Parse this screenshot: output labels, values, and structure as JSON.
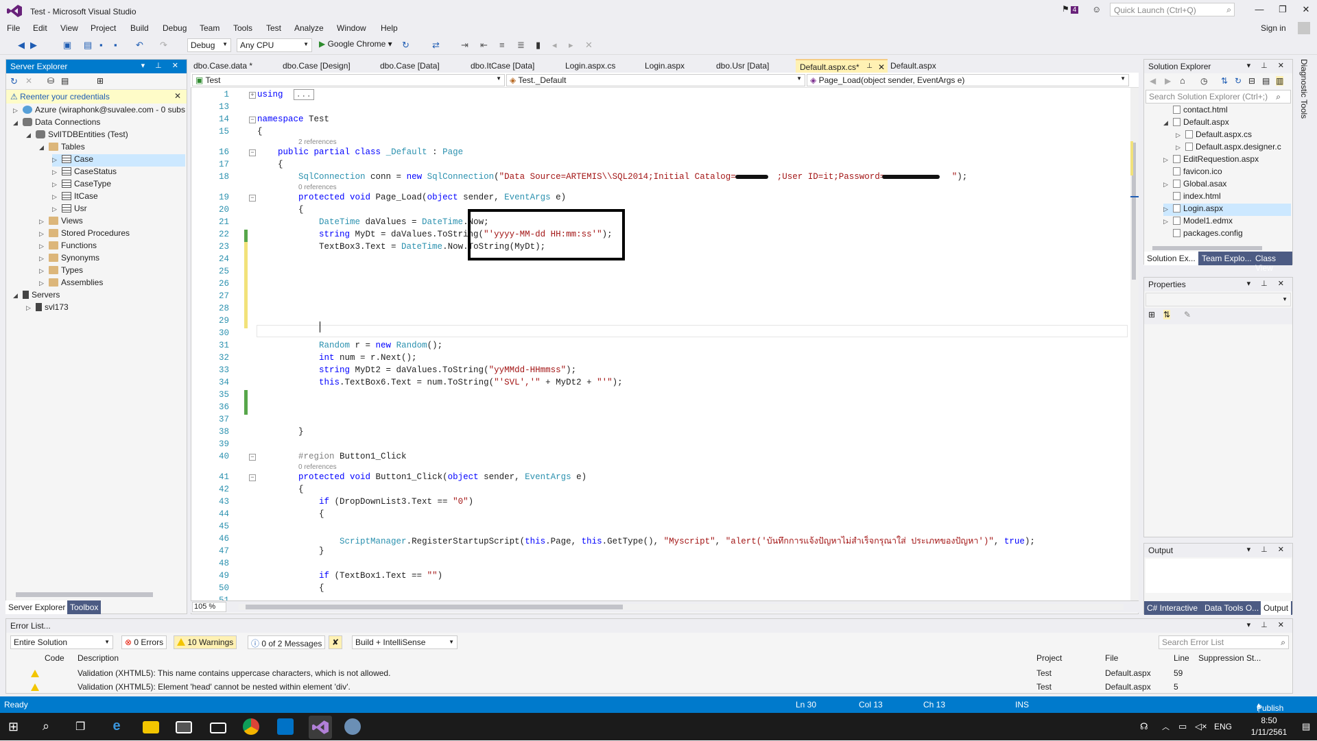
{
  "title": "Test - Microsoft Visual Studio",
  "notif_count": "4",
  "quick_launch_placeholder": "Quick Launch (Ctrl+Q)",
  "menu": [
    "File",
    "Edit",
    "View",
    "Project",
    "Build",
    "Debug",
    "Team",
    "Tools",
    "Test",
    "Analyze",
    "Window",
    "Help"
  ],
  "sign_in": "Sign in",
  "toolbar": {
    "config": "Debug",
    "platform": "Any CPU",
    "run": "Google Chrome"
  },
  "server_explorer": {
    "title": "Server Explorer",
    "warning": "Reenter your credentials",
    "tree": [
      {
        "label": "Azure (wiraphonk@suvalee.com - 0 subs",
        "depth": 0,
        "tw": "▷",
        "icon": "azure"
      },
      {
        "label": "Data Connections",
        "depth": 0,
        "tw": "◢",
        "icon": "db"
      },
      {
        "label": "SvlITDBEntities (Test)",
        "depth": 1,
        "tw": "◢",
        "icon": "db"
      },
      {
        "label": "Tables",
        "depth": 2,
        "tw": "◢",
        "icon": "folder"
      },
      {
        "label": "Case",
        "depth": 3,
        "tw": "▷",
        "icon": "table",
        "selected": true
      },
      {
        "label": "CaseStatus",
        "depth": 3,
        "tw": "▷",
        "icon": "table"
      },
      {
        "label": "CaseType",
        "depth": 3,
        "tw": "▷",
        "icon": "table"
      },
      {
        "label": "ItCase",
        "depth": 3,
        "tw": "▷",
        "icon": "table"
      },
      {
        "label": "Usr",
        "depth": 3,
        "tw": "▷",
        "icon": "table"
      },
      {
        "label": "Views",
        "depth": 2,
        "tw": "▷",
        "icon": "folder"
      },
      {
        "label": "Stored Procedures",
        "depth": 2,
        "tw": "▷",
        "icon": "folder"
      },
      {
        "label": "Functions",
        "depth": 2,
        "tw": "▷",
        "icon": "folder"
      },
      {
        "label": "Synonyms",
        "depth": 2,
        "tw": "▷",
        "icon": "folder"
      },
      {
        "label": "Types",
        "depth": 2,
        "tw": "▷",
        "icon": "folder"
      },
      {
        "label": "Assemblies",
        "depth": 2,
        "tw": "▷",
        "icon": "folder"
      },
      {
        "label": "Servers",
        "depth": 0,
        "tw": "◢",
        "icon": "server"
      },
      {
        "label": "svl173",
        "depth": 1,
        "tw": "▷",
        "icon": "server"
      }
    ],
    "tabs": [
      "Server Explorer",
      "Toolbox"
    ]
  },
  "doc_tabs": [
    "dbo.Case.data *",
    "dbo.Case [Design]",
    "dbo.Case [Data]",
    "dbo.ItCase [Data]",
    "Login.aspx.cs",
    "Login.aspx",
    "dbo.Usr [Data]",
    "Default.aspx.cs*",
    "Default.aspx"
  ],
  "nav": {
    "project": "Test",
    "class": "Test._Default",
    "member": "Page_Load(object sender, EventArgs e)"
  },
  "zoom": "105 %",
  "code_lines": [
    {
      "n": "1",
      "t": [
        [
          "kw",
          "using"
        ],
        [
          "",
          "  "
        ],
        [
          "rg",
          "..."
        ]
      ]
    },
    {
      "n": "13",
      "t": []
    },
    {
      "n": "14",
      "t": [
        [
          "kw",
          "namespace"
        ],
        [
          "",
          " Test"
        ]
      ]
    },
    {
      "n": "15",
      "t": [
        [
          "",
          "{"
        ]
      ]
    },
    {
      "n": "16",
      "t": [
        [
          "",
          "    "
        ],
        [
          "kw",
          "public partial class"
        ],
        [
          "",
          " "
        ],
        [
          "ty",
          "_Default"
        ],
        [
          "",
          " : "
        ],
        [
          "ty",
          "Page"
        ]
      ],
      "refs": "2 references"
    },
    {
      "n": "17",
      "t": [
        [
          "",
          "    {"
        ]
      ]
    },
    {
      "n": "18",
      "t": [
        [
          "",
          "        "
        ],
        [
          "ty",
          "SqlConnection"
        ],
        [
          "",
          " conn = "
        ],
        [
          "kw",
          "new"
        ],
        [
          "",
          " "
        ],
        [
          "ty",
          "SqlConnection"
        ],
        [
          "",
          "("
        ],
        [
          "st",
          "\"Data Source=ARTEMIS\\\\SQL2014;Initial Catalog=        ;User ID=it;Password=             \""
        ],
        [
          "",
          ");"
        ]
      ]
    },
    {
      "n": "19",
      "t": [
        [
          "",
          "        "
        ],
        [
          "kw",
          "protected void"
        ],
        [
          "",
          " Page_Load("
        ],
        [
          "kw",
          "object"
        ],
        [
          "",
          " sender, "
        ],
        [
          "ty",
          "EventArgs"
        ],
        [
          "",
          " e)"
        ]
      ],
      "refs": "0 references"
    },
    {
      "n": "20",
      "t": [
        [
          "",
          "        {"
        ]
      ]
    },
    {
      "n": "21",
      "t": [
        [
          "",
          "            "
        ],
        [
          "ty",
          "DateTime"
        ],
        [
          "",
          " daValues = "
        ],
        [
          "ty",
          "DateTime"
        ],
        [
          "",
          ".Now;"
        ]
      ]
    },
    {
      "n": "22",
      "t": [
        [
          "",
          "            "
        ],
        [
          "kw",
          "string"
        ],
        [
          "",
          " MyDt = daValues.ToString("
        ],
        [
          "st",
          "\"'yyyy-MM-dd HH:mm:ss'\""
        ],
        [
          "",
          ");"
        ]
      ]
    },
    {
      "n": "23",
      "t": [
        [
          "",
          "            TextBox3.Text = "
        ],
        [
          "ty",
          "DateTime"
        ],
        [
          "",
          ".Now.ToString(MyDt);"
        ]
      ]
    },
    {
      "n": "24",
      "t": []
    },
    {
      "n": "25",
      "t": []
    },
    {
      "n": "26",
      "t": []
    },
    {
      "n": "27",
      "t": []
    },
    {
      "n": "28",
      "t": []
    },
    {
      "n": "29",
      "t": []
    },
    {
      "n": "30",
      "t": []
    },
    {
      "n": "31",
      "t": [
        [
          "",
          "            "
        ],
        [
          "ty",
          "Random"
        ],
        [
          "",
          " r = "
        ],
        [
          "kw",
          "new"
        ],
        [
          "",
          " "
        ],
        [
          "ty",
          "Random"
        ],
        [
          "",
          "();"
        ]
      ]
    },
    {
      "n": "32",
      "t": [
        [
          "",
          "            "
        ],
        [
          "kw",
          "int"
        ],
        [
          "",
          " num = r.Next();"
        ]
      ]
    },
    {
      "n": "33",
      "t": [
        [
          "",
          "            "
        ],
        [
          "kw",
          "string"
        ],
        [
          "",
          " MyDt2 = daValues.ToString("
        ],
        [
          "st",
          "\"yyMMdd-HHmmss\""
        ],
        [
          "",
          ");"
        ]
      ]
    },
    {
      "n": "34",
      "t": [
        [
          "",
          "            "
        ],
        [
          "kw",
          "this"
        ],
        [
          "",
          ".TextBox6.Text = num.ToString("
        ],
        [
          "st",
          "\"'SVL','\""
        ],
        [
          "",
          " + MyDt2 + "
        ],
        [
          "st",
          "\"'\""
        ],
        [
          "",
          ");"
        ]
      ]
    },
    {
      "n": "35",
      "t": []
    },
    {
      "n": "36",
      "t": []
    },
    {
      "n": "37",
      "t": []
    },
    {
      "n": "38",
      "t": [
        [
          "",
          "        }"
        ]
      ]
    },
    {
      "n": "39",
      "t": []
    },
    {
      "n": "40",
      "t": [
        [
          "",
          "        "
        ],
        [
          "rg",
          "#region"
        ],
        [
          "",
          " Button1_Click"
        ]
      ]
    },
    {
      "n": "41",
      "t": [
        [
          "",
          "        "
        ],
        [
          "kw",
          "protected void"
        ],
        [
          "",
          " Button1_Click("
        ],
        [
          "kw",
          "object"
        ],
        [
          "",
          " sender, "
        ],
        [
          "ty",
          "EventArgs"
        ],
        [
          "",
          " e)"
        ]
      ],
      "refs": "0 references"
    },
    {
      "n": "42",
      "t": [
        [
          "",
          "        {"
        ]
      ]
    },
    {
      "n": "43",
      "t": [
        [
          "",
          "            "
        ],
        [
          "kw",
          "if"
        ],
        [
          "",
          " (DropDownList3.Text == "
        ],
        [
          "st",
          "\"0\""
        ],
        [
          "",
          ")"
        ]
      ]
    },
    {
      "n": "44",
      "t": [
        [
          "",
          "            {"
        ]
      ]
    },
    {
      "n": "45",
      "t": []
    },
    {
      "n": "46",
      "t": [
        [
          "",
          "                "
        ],
        [
          "ty",
          "ScriptManager"
        ],
        [
          "",
          ".RegisterStartupScript("
        ],
        [
          "kw",
          "this"
        ],
        [
          "",
          ".Page, "
        ],
        [
          "kw",
          "this"
        ],
        [
          "",
          ".GetType(), "
        ],
        [
          "st",
          "\"Myscript\""
        ],
        [
          "",
          ", "
        ],
        [
          "st",
          "\"alert('บันทึกการแจ้งปัญหาไม่สำเร็จกรุณาใส่ ประเภทของปัญหา')\""
        ],
        [
          "",
          ", "
        ],
        [
          "kw",
          "true"
        ],
        [
          "",
          ");"
        ]
      ]
    },
    {
      "n": "47",
      "t": [
        [
          "",
          "            }"
        ]
      ]
    },
    {
      "n": "48",
      "t": []
    },
    {
      "n": "49",
      "t": [
        [
          "",
          "            "
        ],
        [
          "kw",
          "if"
        ],
        [
          "",
          " (TextBox1.Text == "
        ],
        [
          "st",
          "\"\""
        ],
        [
          "",
          ")"
        ]
      ]
    },
    {
      "n": "50",
      "t": [
        [
          "",
          "            {"
        ]
      ]
    },
    {
      "n": "51",
      "t": []
    }
  ],
  "solution_explorer": {
    "title": "Solution Explorer",
    "search": "Search Solution Explorer (Ctrl+;)",
    "items": [
      {
        "label": "contact.html",
        "depth": 1,
        "tw": ""
      },
      {
        "label": "Default.aspx",
        "depth": 1,
        "tw": "◢"
      },
      {
        "label": "Default.aspx.cs",
        "depth": 2,
        "tw": "▷"
      },
      {
        "label": "Default.aspx.designer.c",
        "depth": 2,
        "tw": "▷"
      },
      {
        "label": "EditRequestion.aspx",
        "depth": 1,
        "tw": "▷"
      },
      {
        "label": "favicon.ico",
        "depth": 1,
        "tw": ""
      },
      {
        "label": "Global.asax",
        "depth": 1,
        "tw": "▷"
      },
      {
        "label": "index.html",
        "depth": 1,
        "tw": ""
      },
      {
        "label": "Login.aspx",
        "depth": 1,
        "tw": "▷",
        "selected": true
      },
      {
        "label": "Model1.edmx",
        "depth": 1,
        "tw": "▷"
      },
      {
        "label": "packages.config",
        "depth": 1,
        "tw": ""
      }
    ],
    "tabs": [
      "Solution Ex...",
      "Team Explo...",
      "Class View"
    ]
  },
  "properties": {
    "title": "Properties"
  },
  "output": {
    "title": "Output",
    "tabs": [
      "C# Interactive",
      "Data Tools O...",
      "Output"
    ]
  },
  "side_tab": "Diagnostic Tools",
  "error_list": {
    "title": "Error List...",
    "scope": "Entire Solution",
    "errors": "0 Errors",
    "warnings": "10 Warnings",
    "messages": "0 of 2 Messages",
    "build": "Build + IntelliSense",
    "search": "Search Error List",
    "columns": [
      "Code",
      "Description",
      "Project",
      "File",
      "Line",
      "Suppression St..."
    ],
    "rows": [
      {
        "desc": "Validation (XHTML5): This name contains uppercase characters, which is not allowed.",
        "project": "Test",
        "file": "Default.aspx",
        "line": "59"
      },
      {
        "desc": "Validation (XHTML5): Element 'head' cannot be nested within element 'div'.",
        "project": "Test",
        "file": "Default.aspx",
        "line": "5"
      }
    ]
  },
  "status": {
    "ready": "Ready",
    "ln": "Ln 30",
    "col": "Col 13",
    "ch": "Ch 13",
    "ins": "INS",
    "publish": "Publish"
  },
  "taskbar": {
    "lang": "ENG",
    "time": "8:50",
    "date": "1/11/2561"
  }
}
